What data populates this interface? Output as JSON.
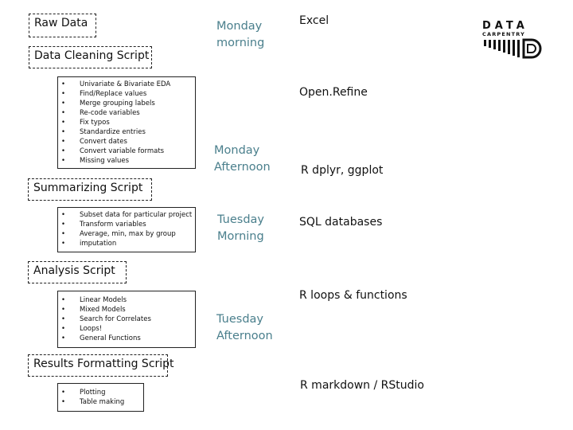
{
  "stages": [
    {
      "title": "Raw Data",
      "items": []
    },
    {
      "title": "Data Cleaning Script",
      "items": [
        "Univariate & Bivariate EDA",
        "Find/Replace values",
        "Merge grouping labels",
        "Re-code variables",
        "Fix typos",
        "Standardize entries",
        "Convert dates",
        "Convert variable formats",
        "Missing values"
      ]
    },
    {
      "title": "Summarizing Script",
      "items": [
        "Subset data for particular project",
        "Transform variables",
        "Average, min, max by group",
        "imputation"
      ]
    },
    {
      "title": "Analysis Script",
      "items": [
        "Linear Models",
        "Mixed Models",
        "Search for Correlates",
        "Loops!",
        "General Functions"
      ]
    },
    {
      "title": "Results Formatting Script",
      "items": [
        "Plotting",
        "Table making"
      ]
    }
  ],
  "times": [
    "Monday morning",
    "Monday Afternoon",
    "Tuesday Morning",
    "Tuesday Afternoon"
  ],
  "tools": [
    "Excel",
    "Open.Refine",
    "R dplyr, ggplot",
    "SQL databases",
    "R loops & functions",
    "R markdown / RStudio"
  ],
  "logo": {
    "line1": "DATA",
    "line2": "CARPENTRY",
    "mark": "D"
  },
  "colors": {
    "time_text": "#4a7f8c"
  }
}
